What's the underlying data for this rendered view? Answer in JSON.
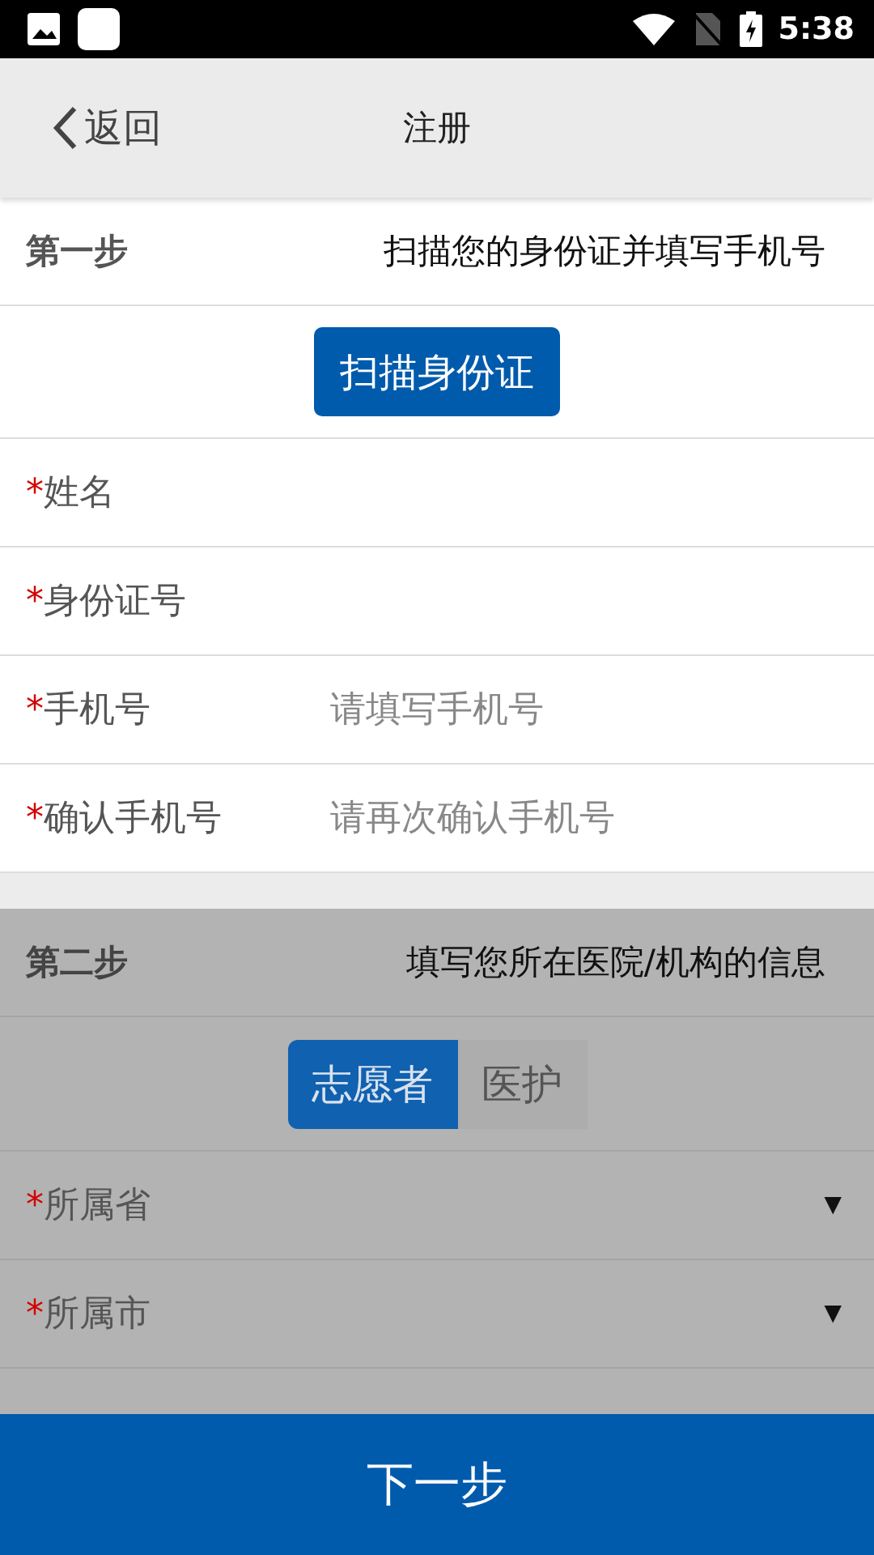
{
  "status_bar": {
    "time": "5:38"
  },
  "header": {
    "back": "返回",
    "title": "注册"
  },
  "step1": {
    "step": "第一步",
    "description": "扫描您的身份证并填写手机号",
    "scan_button": "扫描身份证",
    "fields": [
      {
        "mark": "*",
        "label": "姓名"
      },
      {
        "mark": "*",
        "label": "身份证号"
      },
      {
        "mark": "*",
        "label": "手机号",
        "placeholder": "请填写手机号"
      },
      {
        "mark": "*",
        "label": "确认手机号",
        "placeholder": "请再次确认手机号"
      }
    ]
  },
  "step2": {
    "step": "第二步",
    "description": "填写您所在医院/机构的信息",
    "role_tabs": [
      {
        "label": "志愿者",
        "selected": true
      },
      {
        "label": "医护",
        "selected": false
      }
    ],
    "selects": [
      {
        "mark": "*",
        "label": "所属省",
        "caret": "▼"
      },
      {
        "mark": "*",
        "label": "所属市",
        "caret": "▼"
      }
    ]
  },
  "next_button": "下一步"
}
